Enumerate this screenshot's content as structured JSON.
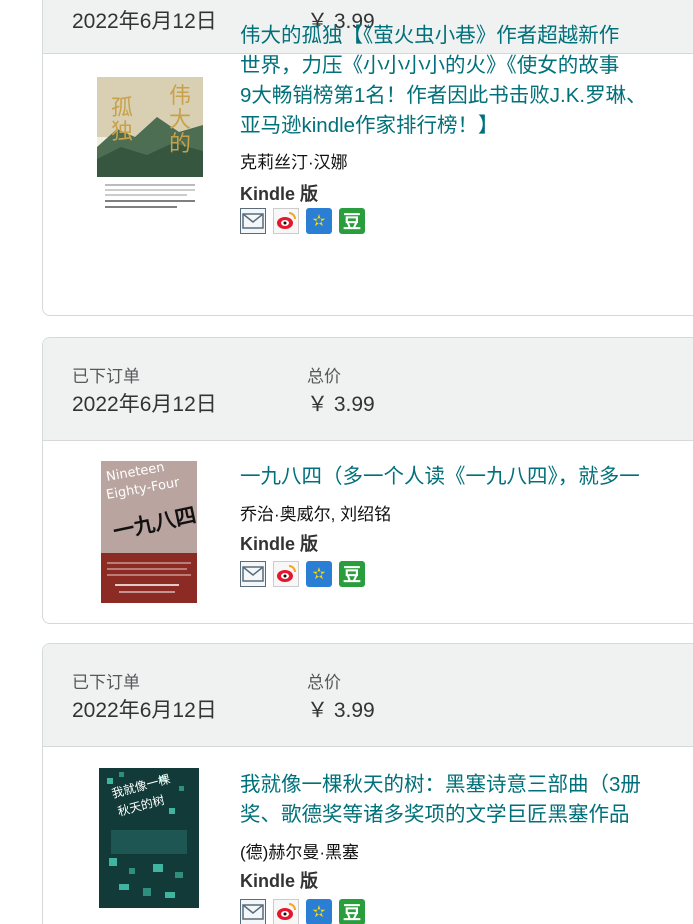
{
  "orders": [
    {
      "date": "2022年6月12日",
      "price": "￥ 3.99",
      "item": {
        "title": "伟大的孤独【《萤火虫小巷》作者超越新作\n世界，力压《小小小小的火》《使女的故事\n9大畅销榜第1名！作者因此书击败J.K.罗琳、\n亚马逊kindle作家排行榜！】",
        "author": "克莉丝汀·汉娜",
        "format": "Kindle 版",
        "cover_text": "伟大的孤独"
      }
    },
    {
      "status_label": "已下订单",
      "date": "2022年6月12日",
      "total_label": "总价",
      "price": "￥ 3.99",
      "item": {
        "title": "一九八四（多一个人读《一九八四》，就多一",
        "author": "乔治·奥威尔, 刘绍铭",
        "format": "Kindle 版",
        "cover_text": "一九八四",
        "cover_subtext": "Nineteen Eighty-Four"
      }
    },
    {
      "status_label": "已下订单",
      "date": "2022年6月12日",
      "total_label": "总价",
      "price": "￥ 3.99",
      "item": {
        "title": "我就像一棵秋天的树：黑塞诗意三部曲（3册\n奖、歌德奖等诸多奖项的文学巨匠黑塞作品",
        "author": "(德)赫尔曼·黑塞",
        "format": "Kindle 版",
        "cover_text": "我就像一棵秋天的树"
      }
    }
  ],
  "share_icons": [
    "mail-icon",
    "weibo-icon",
    "qzone-icon",
    "douban-icon"
  ],
  "share_glyphs": {
    "qzone": "✫",
    "douban": "豆"
  },
  "colors": {
    "link": "#00707a",
    "header_bg": "#f0f2f2",
    "border": "#d5d9d9",
    "qzone": "#2a7fd4",
    "douban": "#2a9d3c",
    "weibo": "#e6162d"
  }
}
